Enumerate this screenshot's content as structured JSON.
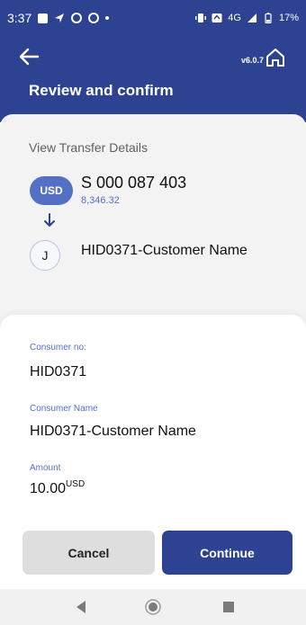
{
  "status_bar": {
    "time": "3:37",
    "network": "4G",
    "battery": "17%"
  },
  "header": {
    "version": "v6.0.7",
    "title": "Review and confirm"
  },
  "transfer": {
    "section_title": "View Transfer Details",
    "from": {
      "currency": "USD",
      "account_number": "S 000 087 403",
      "balance": "8,346.32"
    },
    "to": {
      "initial": "J",
      "name": "HID0371-Customer Name"
    }
  },
  "details": {
    "consumer_no_label": "Consumer no:",
    "consumer_no_value": "HID0371",
    "consumer_name_label": "Consumer Name",
    "consumer_name_value": "HID0371-Customer Name",
    "amount_label": "Amount",
    "amount_value": "10.00",
    "amount_currency": "USD"
  },
  "actions": {
    "cancel_label": "Cancel",
    "continue_label": "Continue"
  },
  "colors": {
    "primary": "#2d4290",
    "accent": "#5470c6",
    "background": "#f3f3f4"
  },
  "icons": [
    "back-arrow-icon",
    "home-icon",
    "down-arrow-icon",
    "nav-back-icon",
    "nav-home-icon",
    "nav-recents-icon"
  ]
}
